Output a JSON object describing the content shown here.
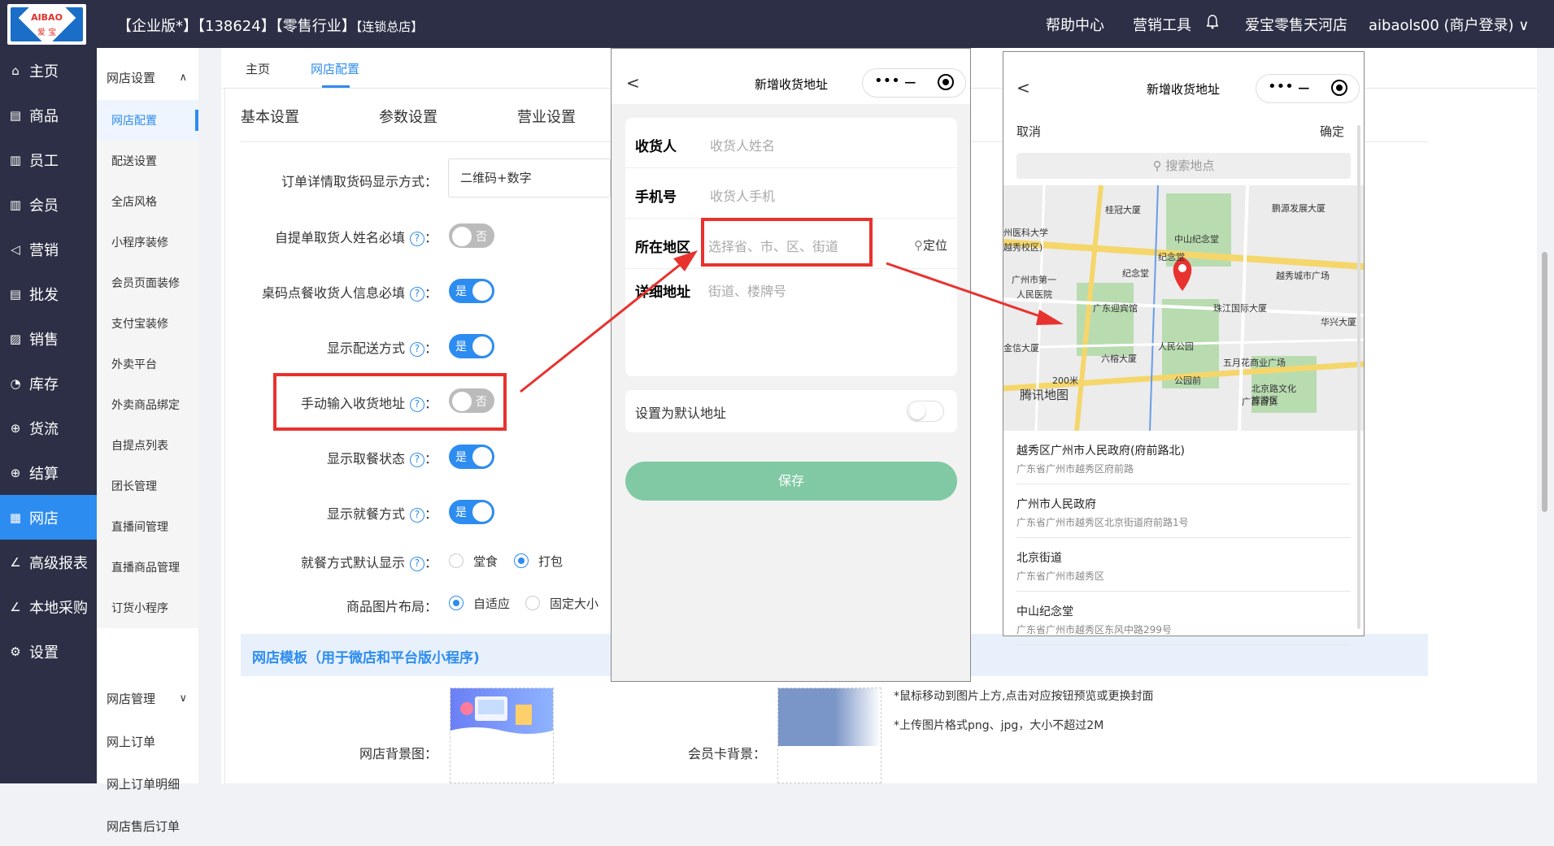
{
  "topbar": {
    "logo_text": "AIBAO",
    "logo_sub": "爱 宝",
    "title_main": "【企业版*】【138624】【零售行业】",
    "title_small": "【连锁总店】",
    "help": "帮助中心",
    "tools": "营销工具",
    "store": "爱宝零售天河店",
    "account": "aibaols00 (商户登录)"
  },
  "sidebar": {
    "items": [
      {
        "icon": "⌂",
        "label": "主页"
      },
      {
        "icon": "▤",
        "label": "商品"
      },
      {
        "icon": "▥",
        "label": "员工"
      },
      {
        "icon": "▥",
        "label": "会员"
      },
      {
        "icon": "◁",
        "label": "营销"
      },
      {
        "icon": "▤",
        "label": "批发"
      },
      {
        "icon": "▨",
        "label": "销售"
      },
      {
        "icon": "◔",
        "label": "库存"
      },
      {
        "icon": "⊕",
        "label": "货流"
      },
      {
        "icon": "⊕",
        "label": "结算"
      },
      {
        "icon": "▦",
        "label": "网店"
      },
      {
        "icon": "∠",
        "label": "高级报表"
      },
      {
        "icon": "∠",
        "label": "本地采购"
      },
      {
        "icon": "⚙",
        "label": "设置"
      }
    ]
  },
  "subnav": {
    "group1": "网店设置",
    "items": [
      "网店配置",
      "配送设置",
      "全店风格",
      "小程序装修",
      "会员页面装修",
      "支付宝装修",
      "外卖平台",
      "外卖商品绑定",
      "自提点列表",
      "团长管理",
      "直播间管理",
      "直播商品管理",
      "订货小程序"
    ],
    "group2": "网店管理",
    "items2": [
      "网上订单",
      "网上订单明细",
      "网店售后订单"
    ]
  },
  "tabs": {
    "home": "主页",
    "config": "网店配置"
  },
  "settings_tabs": [
    "基本设置",
    "参数设置",
    "营业设置"
  ],
  "form": {
    "pickup_code_label": "订单详情取货码显示方式：",
    "pickup_code_value": "二维码+数字",
    "self_pickup_label": "自提单取货人姓名必填",
    "table_label": "桌码点餐收货人信息必填",
    "delivery_label": "显示配送方式",
    "manual_label": "手动输入收货地址",
    "meal_status_label": "显示取餐状态",
    "dining_label": "显示就餐方式",
    "dining_default_label": "就餐方式默认显示",
    "dine_in": "堂食",
    "takeaway": "打包",
    "image_layout_label": "商品图片布局：",
    "adaptive": "自适应",
    "fixed": "固定大小",
    "colon": "：",
    "yes": "是",
    "no": "否",
    "q": "?"
  },
  "template": {
    "title": "网店模板（用于微店和平台版小程序)",
    "bg_label": "网店背景图：",
    "card_label": "会员卡背景：",
    "note1": "*鼠标移动到图片上方,点击对应按钮预览或更换封面",
    "note2": "*上传图片格式png、jpg，大小不超过2M"
  },
  "phone1": {
    "title": "新增收货地址",
    "rows": [
      {
        "label": "收货人",
        "placeholder": "收货人姓名"
      },
      {
        "label": "手机号",
        "placeholder": "收货人手机"
      },
      {
        "label": "所在地区",
        "placeholder": "选择省、市、区、街道"
      },
      {
        "label": "详细地址",
        "placeholder": "街道、楼牌号"
      }
    ],
    "locate": "定位",
    "default_label": "设置为默认地址",
    "save": "保存"
  },
  "phone2": {
    "title": "新增收货地址",
    "cancel": "取消",
    "confirm": "确定",
    "search_placeholder": "搜索地点",
    "map_labels": [
      "桂冠大厦",
      "鹏源发展大厦",
      "州医科大学",
      "越秀校区)",
      "中山纪念堂",
      "纪念堂",
      "纪念堂",
      "越秀城市广场",
      "广州市第一",
      "人民医院",
      "广东迎宾馆",
      "珠江国际大厦",
      "华兴大厦",
      "人民公园",
      "金信大厦",
      "六榕大厦",
      "五月花商业广场",
      "公园前",
      "北京路文化",
      "旅游区",
      "广百百货",
      "腾讯地图",
      "200米"
    ],
    "results": [
      {
        "title": "越秀区广州市人民政府(府前路北)",
        "sub": "广东省广州市越秀区府前路"
      },
      {
        "title": "广州市人民政府",
        "sub": "广东省广州市越秀区北京街道府前路1号"
      },
      {
        "title": "北京街道",
        "sub": "广东省广州市越秀区"
      },
      {
        "title": "中山纪念堂",
        "sub": "广东省广州市越秀区东风中路299号"
      }
    ]
  },
  "colors": {
    "accent": "#2d8cf0",
    "dark": "#2c2f45",
    "red": "#e8322e",
    "green": "#80c9a4"
  }
}
